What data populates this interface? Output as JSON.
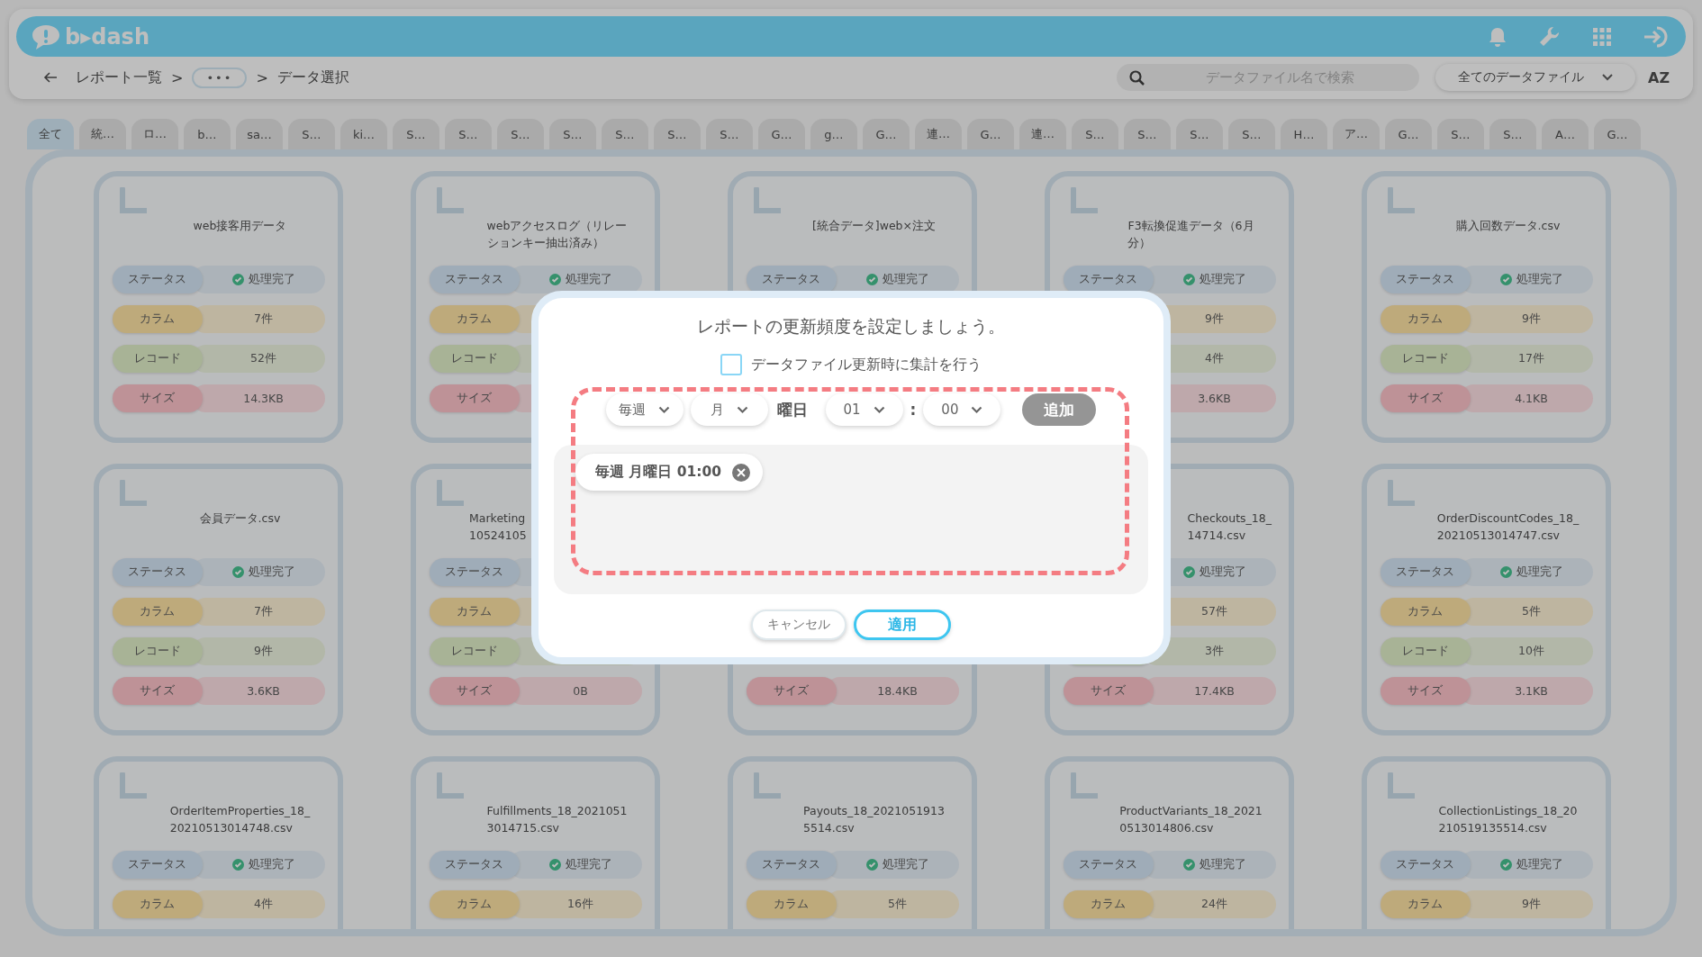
{
  "header": {
    "logo": "b▸dash"
  },
  "toolbar": {
    "breadcrumb": [
      {
        "kind": "link",
        "text": "レポート一覧"
      },
      {
        "kind": "sep",
        "text": ">"
      },
      {
        "kind": "more",
        "text": "•••"
      },
      {
        "kind": "sep",
        "text": ">"
      },
      {
        "kind": "current",
        "text": "データ選択"
      }
    ],
    "search": {
      "placeholder": "データファイル名で検索"
    },
    "filter": {
      "value": "全てのデータファイル"
    },
    "sort": "AZ"
  },
  "tabs": [
    {
      "label": "全て",
      "selected": true
    },
    {
      "label": "統…",
      "selected": false
    },
    {
      "label": "ロ…",
      "selected": false
    },
    {
      "label": "b…",
      "selected": false
    },
    {
      "label": "sa…",
      "selected": false
    },
    {
      "label": "S…",
      "selected": false
    },
    {
      "label": "ki…",
      "selected": false
    },
    {
      "label": "S…",
      "selected": false
    },
    {
      "label": "S…",
      "selected": false
    },
    {
      "label": "S…",
      "selected": false
    },
    {
      "label": "S…",
      "selected": false
    },
    {
      "label": "S…",
      "selected": false
    },
    {
      "label": "S…",
      "selected": false
    },
    {
      "label": "S…",
      "selected": false
    },
    {
      "label": "G…",
      "selected": false
    },
    {
      "label": "g…",
      "selected": false
    },
    {
      "label": "G…",
      "selected": false
    },
    {
      "label": "連…",
      "selected": false
    },
    {
      "label": "G…",
      "selected": false
    },
    {
      "label": "連…",
      "selected": false
    },
    {
      "label": "S…",
      "selected": false
    },
    {
      "label": "S…",
      "selected": false
    },
    {
      "label": "S…",
      "selected": false
    },
    {
      "label": "S…",
      "selected": false
    },
    {
      "label": "H…",
      "selected": false
    },
    {
      "label": "ア…",
      "selected": false
    },
    {
      "label": "G…",
      "selected": false
    },
    {
      "label": "S…",
      "selected": false
    },
    {
      "label": "S…",
      "selected": false
    },
    {
      "label": "A…",
      "selected": false
    },
    {
      "label": "G…",
      "selected": false
    }
  ],
  "cards": [
    {
      "title_lines": [
        "web接客用データ"
      ],
      "rows": [
        {
          "kind": "status",
          "label": "ステータス",
          "value": "処理完了"
        },
        {
          "kind": "column",
          "label": "カラム",
          "value": "7件"
        },
        {
          "kind": "record",
          "label": "レコード",
          "value": "52件"
        },
        {
          "kind": "size",
          "label": "サイズ",
          "value": "14.3KB"
        }
      ]
    },
    {
      "title_lines": [
        "webアクセスログ（リレー",
        "ションキー抽出済み）"
      ],
      "rows": [
        {
          "kind": "status",
          "label": "ステータス",
          "value": "処理完了"
        },
        {
          "kind": "column",
          "label": "カラム"
        },
        {
          "kind": "record",
          "label": "レコード"
        },
        {
          "kind": "size",
          "label": "サイズ"
        }
      ]
    },
    {
      "title_lines": [
        "[統合データ]web×注文"
      ],
      "rows": [
        {
          "kind": "status",
          "label": "ステータス",
          "value": "処理完了"
        }
      ]
    },
    {
      "title_lines": [
        "F3転換促進データ（6月",
        "分）"
      ],
      "rows": [
        {
          "kind": "status",
          "label": "ステータス",
          "value": "処理完了"
        },
        {
          "kind": "column",
          "value": "9件"
        },
        {
          "kind": "record",
          "value": "4件"
        },
        {
          "kind": "size",
          "value": "3.6KB"
        }
      ]
    },
    {
      "title_lines": [
        "購入回数データ.csv"
      ],
      "rows": [
        {
          "kind": "status",
          "label": "ステータス",
          "value": "処理完了"
        },
        {
          "kind": "column",
          "label": "カラム",
          "value": "9件"
        },
        {
          "kind": "record",
          "label": "レコード",
          "value": "17件"
        },
        {
          "kind": "size",
          "label": "サイズ",
          "value": "4.1KB"
        }
      ]
    },
    {
      "title_lines": [
        "会員データ.csv"
      ],
      "rows": [
        {
          "kind": "status",
          "label": "ステータス",
          "value": "処理完了"
        },
        {
          "kind": "column",
          "label": "カラム",
          "value": "7件"
        },
        {
          "kind": "record",
          "label": "レコード",
          "value": "9件"
        },
        {
          "kind": "size",
          "label": "サイズ",
          "value": "3.6KB"
        }
      ]
    },
    {
      "title_lines": [
        "Marketing",
        "10524105"
      ],
      "cut_right": true,
      "rows": [
        {
          "kind": "status",
          "label": "ステータス"
        },
        {
          "kind": "column",
          "label": "カラム"
        },
        {
          "kind": "record",
          "label": "レコード"
        },
        {
          "kind": "size",
          "label": "サイズ",
          "value": "0B"
        }
      ]
    },
    {
      "rows": [
        {
          "kind": "size",
          "label": "サイズ",
          "value": "18.4KB"
        }
      ]
    },
    {
      "title_lines": [
        "Checkouts_18_",
        "14714.csv"
      ],
      "cut_left": true,
      "rows": [
        {
          "kind": "status",
          "value": "処理完了"
        },
        {
          "kind": "column",
          "value": "57件"
        },
        {
          "kind": "record",
          "value": "3件"
        },
        {
          "kind": "size",
          "label": "サイズ",
          "value": "17.4KB"
        }
      ]
    },
    {
      "title_lines": [
        "OrderDiscountCodes_18_",
        "20210513014747.csv"
      ],
      "rows": [
        {
          "kind": "status",
          "label": "ステータス",
          "value": "処理完了"
        },
        {
          "kind": "column",
          "label": "カラム",
          "value": "5件"
        },
        {
          "kind": "record",
          "label": "レコード",
          "value": "10件"
        },
        {
          "kind": "size",
          "label": "サイズ",
          "value": "3.1KB"
        }
      ]
    },
    {
      "title_lines": [
        "OrderItemProperties_18_",
        "20210513014748.csv"
      ],
      "rows": [
        {
          "kind": "status",
          "label": "ステータス",
          "value": "処理完了"
        },
        {
          "kind": "column",
          "label": "カラム",
          "value": "4件"
        }
      ]
    },
    {
      "title_lines": [
        "Fulfillments_18_2021051",
        "3014715.csv"
      ],
      "rows": [
        {
          "kind": "status",
          "label": "ステータス",
          "value": "処理完了"
        },
        {
          "kind": "column",
          "label": "カラム",
          "value": "16件"
        }
      ]
    },
    {
      "title_lines": [
        "Payouts_18_2021051913",
        "5514.csv"
      ],
      "rows": [
        {
          "kind": "status",
          "label": "ステータス",
          "value": "処理完了"
        },
        {
          "kind": "column",
          "label": "カラム",
          "value": "5件"
        }
      ]
    },
    {
      "title_lines": [
        "ProductVariants_18_2021",
        "0513014806.csv"
      ],
      "rows": [
        {
          "kind": "status",
          "label": "ステータス",
          "value": "処理完了"
        },
        {
          "kind": "column",
          "label": "カラム",
          "value": "24件"
        }
      ]
    },
    {
      "title_lines": [
        "CollectionListings_18_20",
        "210519135514.csv"
      ],
      "rows": [
        {
          "kind": "status",
          "label": "ステータス",
          "value": "処理完了"
        },
        {
          "kind": "column",
          "label": "カラム",
          "value": "9件"
        }
      ]
    }
  ],
  "modal": {
    "title": "レポートの更新頻度を設定しましょう。",
    "checkbox": {
      "label": "データファイル更新時に集計を行う",
      "checked": false
    },
    "schedule": [
      {
        "kind": "select",
        "value": "毎週"
      },
      {
        "kind": "select",
        "value": "月"
      },
      {
        "kind": "text",
        "value": "曜日"
      },
      {
        "kind": "select",
        "value": "01"
      },
      {
        "kind": "colon",
        "value": ":"
      },
      {
        "kind": "select",
        "value": "00"
      },
      {
        "kind": "add",
        "value": "追加",
        "disabled": true
      }
    ],
    "entries": [
      {
        "text": "毎週 月曜日 01:00"
      }
    ],
    "buttons": [
      {
        "kind": "cancel",
        "label": "キャンセル"
      },
      {
        "kind": "apply",
        "label": "適用"
      }
    ]
  }
}
